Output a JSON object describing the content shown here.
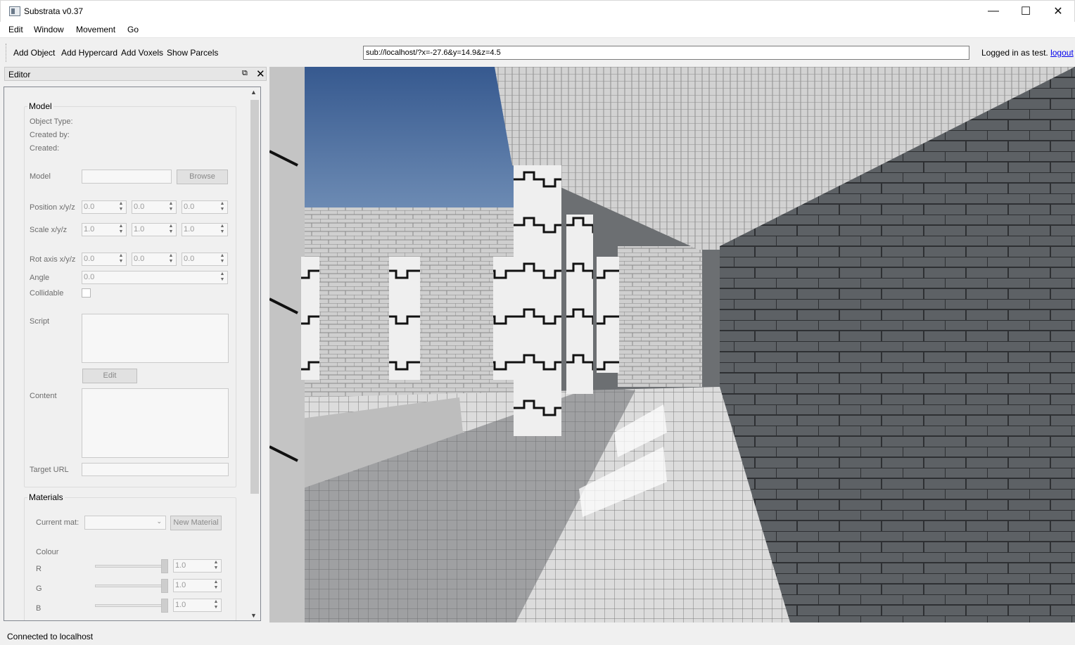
{
  "window": {
    "title": "Substrata v0.37",
    "minimize_glyph": "—",
    "maximize_glyph": "☐",
    "close_glyph": "✕"
  },
  "menu": [
    "Edit",
    "Window",
    "Movement",
    "Go"
  ],
  "toolbar": {
    "buttons": [
      "Add Object",
      "Add Hypercard",
      "Add Voxels",
      "Show Parcels"
    ],
    "url": "sub://localhost/?x=-27.6&y=14.9&z=4.5",
    "login_text": "Logged in as test.",
    "logout_label": "logout"
  },
  "editor": {
    "title": "Editor",
    "model_group": {
      "title": "Model",
      "object_type_label": "Object Type:",
      "created_by_label": "Created by:",
      "created_label": "Created:",
      "model_label": "Model",
      "browse_label": "Browse",
      "position_label": "Position x/y/z",
      "position": [
        "0.0",
        "0.0",
        "0.0"
      ],
      "scale_label": "Scale x/y/z",
      "scale": [
        "1.0",
        "1.0",
        "1.0"
      ],
      "rot_axis_label": "Rot axis x/y/z",
      "rot_axis": [
        "0.0",
        "0.0",
        "0.0"
      ],
      "angle_label": "Angle",
      "angle": "0.0",
      "collidable_label": "Collidable",
      "collidable": false,
      "script_label": "Script",
      "edit_label": "Edit",
      "content_label": "Content",
      "target_url_label": "Target URL"
    },
    "materials_group": {
      "title": "Materials",
      "current_mat_label": "Current mat:",
      "new_material_label": "New Material",
      "colour_label": "Colour",
      "r_label": "R",
      "r_value": "1.0",
      "g_label": "G",
      "g_value": "1.0",
      "b_label": "B",
      "b_value": "1.0"
    }
  },
  "status": {
    "text": "Connected to localhost"
  },
  "colors": {
    "sky": "#3f6aa6",
    "wall_light": "#c9c9c9",
    "wall_dark": "#5f6367",
    "floor": "#9a9c9f",
    "link": "#0000ee"
  }
}
